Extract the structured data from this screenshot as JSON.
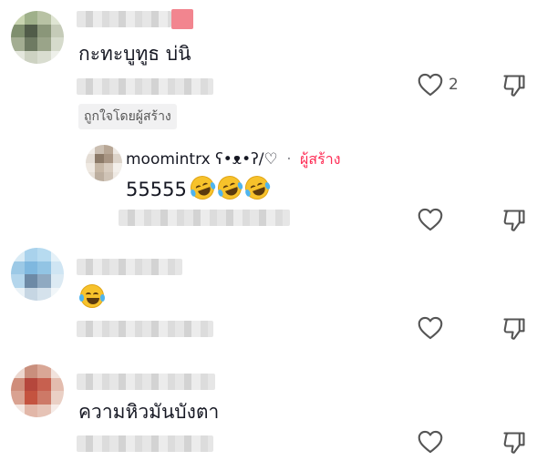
{
  "comments": [
    {
      "text": "กะทะบูทูธ บ่นิ",
      "like_count": "2",
      "liked_by_creator_label": "ถูกใจโดยผู้สร้าง"
    },
    {
      "reply_username": "moomintrx ʕ•ᴥ•ʔ/♡",
      "creator_label": "ผู้สร้าง",
      "separator": "·",
      "text": "55555"
    },
    {
      "text": ""
    },
    {
      "text": "ความหิวมันบังตา"
    }
  ],
  "colors": {
    "creator_accent": "#fe2c55",
    "text_primary": "#161823",
    "icon_gray": "#555555"
  },
  "icons": [
    "heart-outline-icon",
    "thumbs-down-icon"
  ]
}
